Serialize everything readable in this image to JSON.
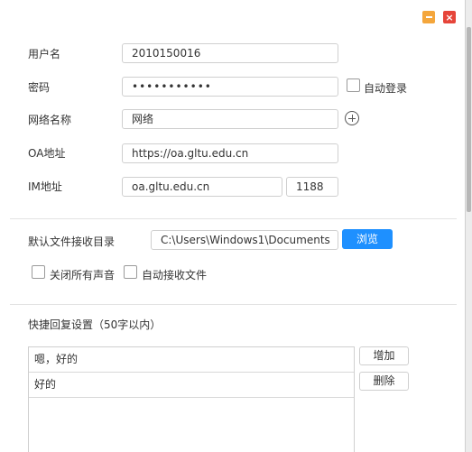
{
  "form": {
    "username_label": "用户名",
    "username_value": "2010150016",
    "password_label": "密码",
    "password_value": "•••••••••••",
    "auto_login_label": "自动登录",
    "network_name_label": "网络名称",
    "network_name_value": "网络",
    "oa_address_label": "OA地址",
    "oa_address_value": "https://oa.gltu.edu.cn",
    "im_address_label": "IM地址",
    "im_host_value": "oa.gltu.edu.cn",
    "im_port_value": "1188"
  },
  "files": {
    "receive_dir_label": "默认文件接收目录",
    "receive_dir_value": "C:\\Users\\Windows1\\Documents",
    "browse_label": "浏览",
    "mute_all_label": "关闭所有声音",
    "auto_receive_label": "自动接收文件"
  },
  "quick_reply": {
    "title": "快捷回复设置（50字以内）",
    "items": [
      "嗯，好的",
      "好的"
    ],
    "add_label": "增加",
    "delete_label": "删除"
  },
  "colors": {
    "primary": "#1e90ff",
    "minimize": "#f4a63b",
    "close": "#e6453a"
  },
  "icons": {
    "add_network": "plus-circle-icon",
    "minimize": "minimize-icon",
    "close": "close-icon"
  }
}
